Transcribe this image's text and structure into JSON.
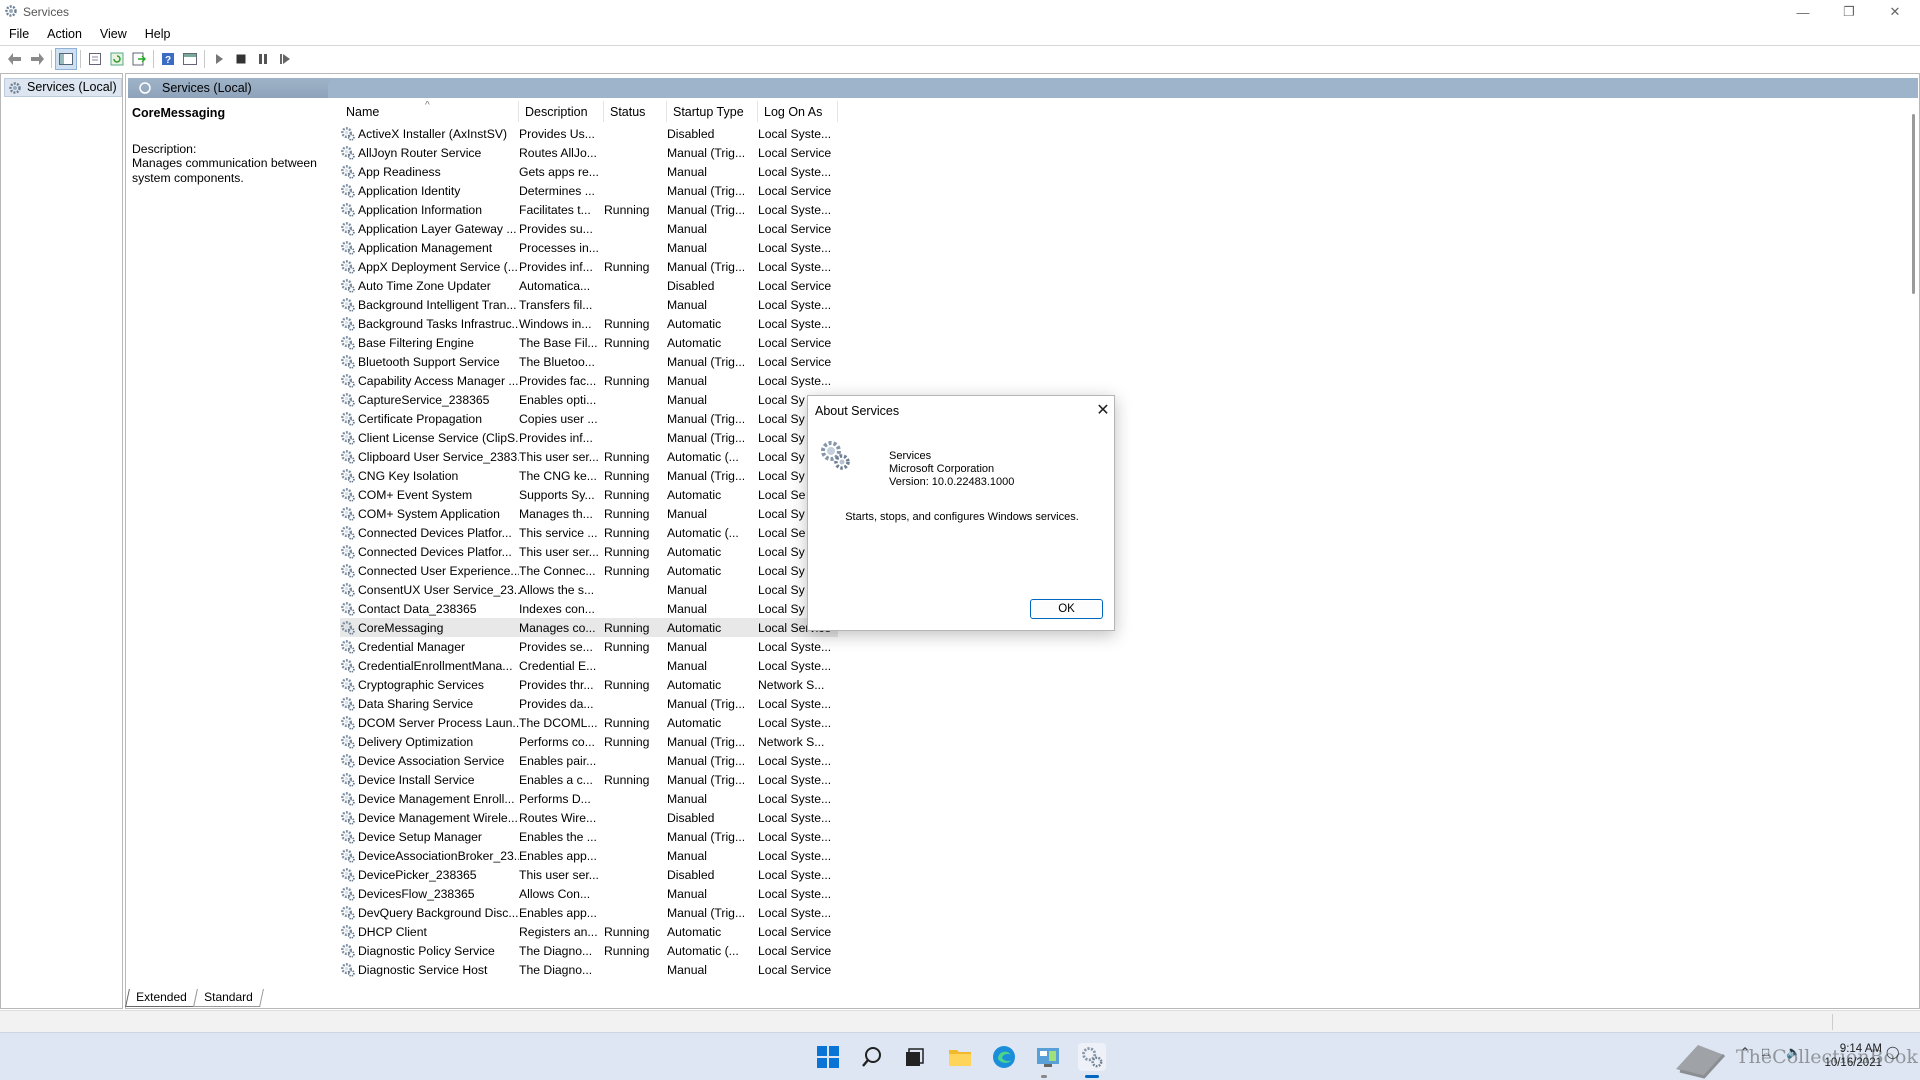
{
  "window": {
    "title": "Services"
  },
  "menu": [
    "File",
    "Action",
    "View",
    "Help"
  ],
  "toolbar": {
    "icons": [
      "back-arrow-icon",
      "forward-arrow-icon",
      "show-hide-tree-icon",
      "properties-icon",
      "refresh-icon",
      "export-list-icon",
      "help-icon",
      "mmc-console-icon",
      "start-service-icon",
      "stop-service-icon",
      "pause-service-icon",
      "resume-service-icon"
    ]
  },
  "tree": {
    "root": "Services (Local)"
  },
  "pane": {
    "header": "Services (Local)"
  },
  "details": {
    "service_name": "CoreMessaging",
    "description_label": "Description:",
    "description_text": "Manages communication between system components."
  },
  "columns": [
    "Name",
    "Description",
    "Status",
    "Startup Type",
    "Log On As"
  ],
  "services": [
    [
      "ActiveX Installer (AxInstSV)",
      "Provides Us...",
      "",
      "Disabled",
      "Local Syste..."
    ],
    [
      "AllJoyn Router Service",
      "Routes AllJo...",
      "",
      "Manual (Trig...",
      "Local Service"
    ],
    [
      "App Readiness",
      "Gets apps re...",
      "",
      "Manual",
      "Local Syste..."
    ],
    [
      "Application Identity",
      "Determines ...",
      "",
      "Manual (Trig...",
      "Local Service"
    ],
    [
      "Application Information",
      "Facilitates t...",
      "Running",
      "Manual (Trig...",
      "Local Syste..."
    ],
    [
      "Application Layer Gateway ...",
      "Provides su...",
      "",
      "Manual",
      "Local Service"
    ],
    [
      "Application Management",
      "Processes in...",
      "",
      "Manual",
      "Local Syste..."
    ],
    [
      "AppX Deployment Service (...",
      "Provides inf...",
      "Running",
      "Manual (Trig...",
      "Local Syste..."
    ],
    [
      "Auto Time Zone Updater",
      "Automatica...",
      "",
      "Disabled",
      "Local Service"
    ],
    [
      "Background Intelligent Tran...",
      "Transfers fil...",
      "",
      "Manual",
      "Local Syste..."
    ],
    [
      "Background Tasks Infrastruc...",
      "Windows in...",
      "Running",
      "Automatic",
      "Local Syste..."
    ],
    [
      "Base Filtering Engine",
      "The Base Fil...",
      "Running",
      "Automatic",
      "Local Service"
    ],
    [
      "Bluetooth Support Service",
      "The Bluetoo...",
      "",
      "Manual (Trig...",
      "Local Service"
    ],
    [
      "Capability Access Manager ...",
      "Provides fac...",
      "Running",
      "Manual",
      "Local Syste..."
    ],
    [
      "CaptureService_238365",
      "Enables opti...",
      "",
      "Manual",
      "Local Sy"
    ],
    [
      "Certificate Propagation",
      "Copies user ...",
      "",
      "Manual (Trig...",
      "Local Sy"
    ],
    [
      "Client License Service (ClipS...",
      "Provides inf...",
      "",
      "Manual (Trig...",
      "Local Sy"
    ],
    [
      "Clipboard User Service_2383...",
      "This user ser...",
      "Running",
      "Automatic (...",
      "Local Sy"
    ],
    [
      "CNG Key Isolation",
      "The CNG ke...",
      "Running",
      "Manual (Trig...",
      "Local Sy"
    ],
    [
      "COM+ Event System",
      "Supports Sy...",
      "Running",
      "Automatic",
      "Local Se"
    ],
    [
      "COM+ System Application",
      "Manages th...",
      "Running",
      "Manual",
      "Local Sy"
    ],
    [
      "Connected Devices Platfor...",
      "This service ...",
      "Running",
      "Automatic (...",
      "Local Se"
    ],
    [
      "Connected Devices Platfor...",
      "This user ser...",
      "Running",
      "Automatic",
      "Local Sy"
    ],
    [
      "Connected User Experience...",
      "The Connec...",
      "Running",
      "Automatic",
      "Local Sy"
    ],
    [
      "ConsentUX User Service_23...",
      "Allows the s...",
      "",
      "Manual",
      "Local Sy"
    ],
    [
      "Contact Data_238365",
      "Indexes con...",
      "",
      "Manual",
      "Local Sy"
    ],
    [
      "CoreMessaging",
      "Manages co...",
      "Running",
      "Automatic",
      "Local Service"
    ],
    [
      "Credential Manager",
      "Provides se...",
      "Running",
      "Manual",
      "Local Syste..."
    ],
    [
      "CredentialEnrollmentMana...",
      "Credential E...",
      "",
      "Manual",
      "Local Syste..."
    ],
    [
      "Cryptographic Services",
      "Provides thr...",
      "Running",
      "Automatic",
      "Network S..."
    ],
    [
      "Data Sharing Service",
      "Provides da...",
      "",
      "Manual (Trig...",
      "Local Syste..."
    ],
    [
      "DCOM Server Process Laun...",
      "The DCOML...",
      "Running",
      "Automatic",
      "Local Syste..."
    ],
    [
      "Delivery Optimization",
      "Performs co...",
      "Running",
      "Manual (Trig...",
      "Network S..."
    ],
    [
      "Device Association Service",
      "Enables pair...",
      "",
      "Manual (Trig...",
      "Local Syste..."
    ],
    [
      "Device Install Service",
      "Enables a c...",
      "Running",
      "Manual (Trig...",
      "Local Syste..."
    ],
    [
      "Device Management Enroll...",
      "Performs D...",
      "",
      "Manual",
      "Local Syste..."
    ],
    [
      "Device Management Wirele...",
      "Routes Wire...",
      "",
      "Disabled",
      "Local Syste..."
    ],
    [
      "Device Setup Manager",
      "Enables the ...",
      "",
      "Manual (Trig...",
      "Local Syste..."
    ],
    [
      "DeviceAssociationBroker_23...",
      "Enables app...",
      "",
      "Manual",
      "Local Syste..."
    ],
    [
      "DevicePicker_238365",
      "This user ser...",
      "",
      "Disabled",
      "Local Syste..."
    ],
    [
      "DevicesFlow_238365",
      "Allows Con...",
      "",
      "Manual",
      "Local Syste..."
    ],
    [
      "DevQuery Background Disc...",
      "Enables app...",
      "",
      "Manual (Trig...",
      "Local Syste..."
    ],
    [
      "DHCP Client",
      "Registers an...",
      "Running",
      "Automatic",
      "Local Service"
    ],
    [
      "Diagnostic Policy Service",
      "The Diagno...",
      "Running",
      "Automatic (...",
      "Local Service"
    ],
    [
      "Diagnostic Service Host",
      "The Diagno...",
      "",
      "Manual",
      "Local Service"
    ]
  ],
  "selected_index": 26,
  "tabs": [
    "Extended",
    "Standard"
  ],
  "dialog": {
    "title": "About Services",
    "product": "Services",
    "company": "Microsoft Corporation",
    "version": "Version: 10.0.22483.1000",
    "description": "Starts, stops, and configures Windows services.",
    "ok_label": "OK"
  },
  "taskbar": {
    "icons": [
      "windows-start-icon",
      "search-icon",
      "task-view-icon",
      "file-explorer-icon",
      "edge-browser-icon",
      "control-panel-icon",
      "services-app-icon"
    ],
    "time": "9:14 AM",
    "date": "10/16/2021"
  },
  "watermark": "TheCollectionBook",
  "colors": {
    "accent": "#0067c0",
    "header_band": "#9eb4cb",
    "selection": "#e8e8e8",
    "taskbar": "#dde6f2"
  }
}
